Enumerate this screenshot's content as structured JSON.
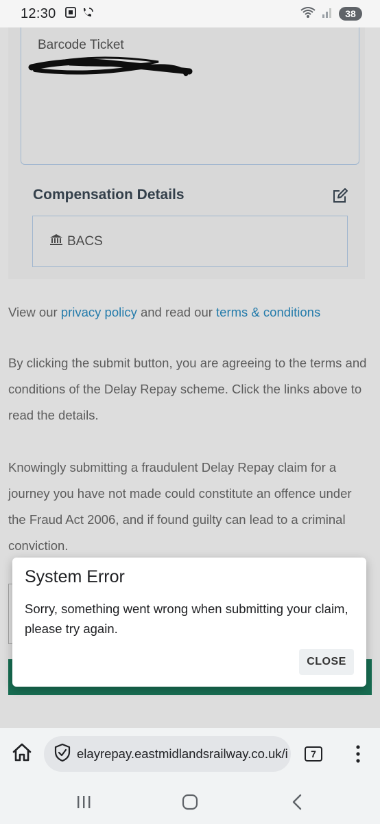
{
  "status_bar": {
    "time": "12:30",
    "battery": "38"
  },
  "ticket": {
    "label": "Barcode Ticket"
  },
  "compensation": {
    "title": "Compensation Details",
    "method": "BACS"
  },
  "policy": {
    "prefix": "View our ",
    "privacy_link": "privacy policy",
    "middle": " and read our ",
    "terms_link": "terms & conditions"
  },
  "agreement_text": "By clicking the submit button, you are agreeing to the terms and conditions of the Delay Repay scheme. Click the links above to read the details.",
  "fraud_text": "Knowingly submitting a fraudulent Delay Repay claim for a journey you have not made could constitute an offence under the Fraud Act 2006, and if found guilty can lead to a criminal conviction.",
  "dialog": {
    "title": "System Error",
    "message": "Sorry, something went wrong when submitting your claim, please try again.",
    "close_label": "CLOSE"
  },
  "browser": {
    "url": "elayrepay.eastmidlandsrailway.co.uk/i",
    "tab_count": "7"
  },
  "colors": {
    "link": "#2b8fc6",
    "submit_bar": "#1b7e5f",
    "box_border": "#b9d3ef"
  }
}
